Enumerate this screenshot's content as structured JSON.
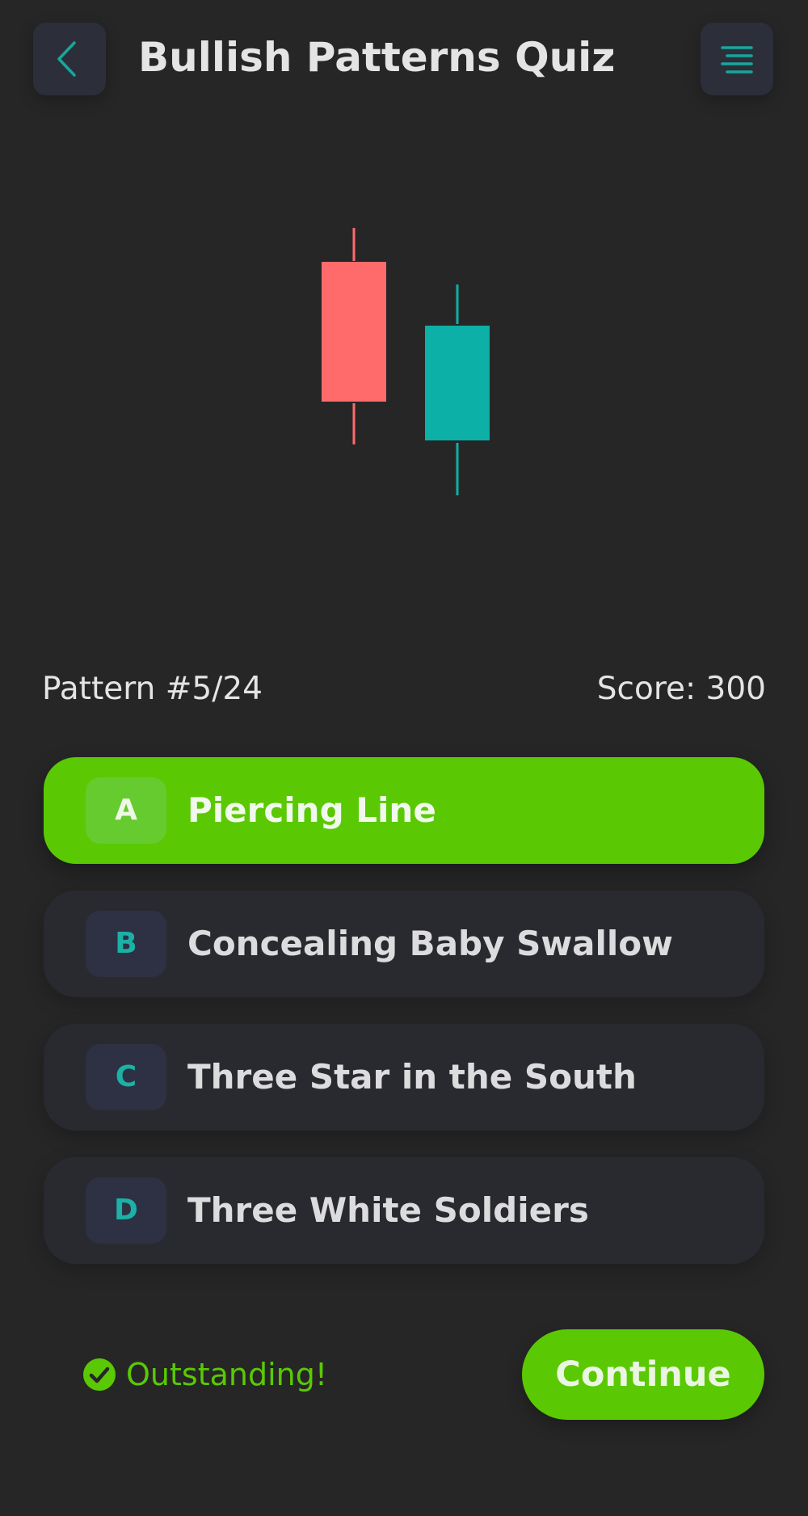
{
  "header": {
    "title": "Bullish Patterns Quiz",
    "back_icon": "chevron-left-icon",
    "menu_icon": "menu-icon"
  },
  "illustration": {
    "candles": [
      {
        "direction": "bearish",
        "color": "#ff6b6b"
      },
      {
        "direction": "bullish",
        "color": "#0db0a7"
      }
    ]
  },
  "progress": {
    "pattern_label": "Pattern #5/24",
    "score_label": "Score: 300"
  },
  "options": [
    {
      "letter": "A",
      "text": "Piercing Line",
      "selected": true
    },
    {
      "letter": "B",
      "text": "Concealing Baby Swallow",
      "selected": false
    },
    {
      "letter": "C",
      "text": "Three Star in the South",
      "selected": false
    },
    {
      "letter": "D",
      "text": "Three White Soldiers",
      "selected": false
    }
  ],
  "footer": {
    "feedback_icon": "check-circle-icon",
    "feedback_text": "Outstanding!",
    "continue_label": "Continue"
  },
  "colors": {
    "background": "#262627",
    "accent_green": "#5ac904",
    "accent_teal": "#1bb1a6",
    "bearish_red": "#ff6b6b",
    "card": "#292a2f"
  }
}
